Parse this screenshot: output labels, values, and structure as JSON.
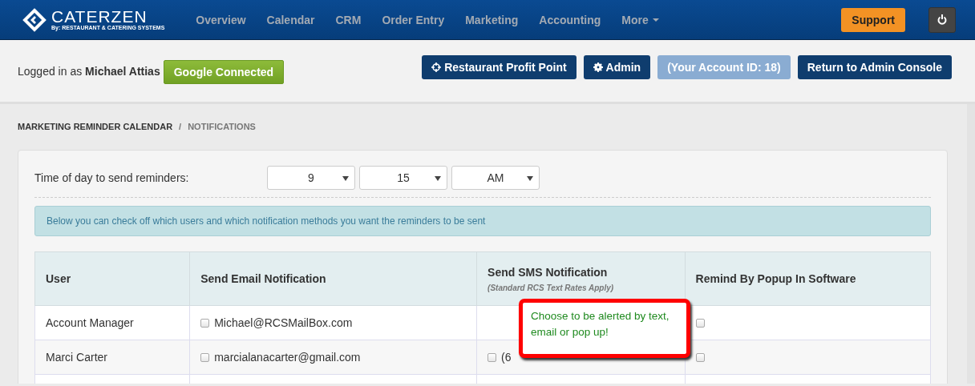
{
  "header": {
    "logo": {
      "name": "CATERZEN",
      "tagline": "By: RESTAURANT & CATERING SYSTEMS"
    },
    "nav": [
      {
        "label": "Overview"
      },
      {
        "label": "Calendar"
      },
      {
        "label": "CRM"
      },
      {
        "label": "Order Entry"
      },
      {
        "label": "Marketing"
      },
      {
        "label": "Accounting"
      },
      {
        "label": "More",
        "dropdown": true
      }
    ],
    "support_button": "Support"
  },
  "user_bar": {
    "logged_in_prefix": "Logged in as",
    "user_name": "Michael Attias",
    "google_button": "Google Connected",
    "buttons": [
      {
        "label": "Restaurant Profit Point",
        "disabled": false
      },
      {
        "label": "Admin",
        "disabled": false
      },
      {
        "label": "(Your Account ID: 18)",
        "disabled": true
      },
      {
        "label": "Return to Admin Console",
        "disabled": false
      }
    ]
  },
  "breadcrumb": {
    "separator": "/",
    "items": [
      {
        "label": "MARKETING REMINDER CALENDAR",
        "current": false
      },
      {
        "label": "NOTIFICATIONS",
        "current": true
      }
    ]
  },
  "time_setting": {
    "label": "Time of day to send reminders:",
    "selects": [
      {
        "value": "9"
      },
      {
        "value": "15"
      },
      {
        "value": "AM"
      }
    ]
  },
  "info_message": "Below you can check off which users and which notification methods you want the reminders to be sent",
  "table": {
    "columns": [
      {
        "title": "User"
      },
      {
        "title": "Send Email Notification"
      },
      {
        "title": "Send SMS Notification",
        "note": "(Standard RCS Text Rates Apply)"
      },
      {
        "title": "Remind By Popup In Software"
      }
    ],
    "rows": [
      {
        "user": "Account Manager",
        "email": {
          "checked": false,
          "text": "Michael@RCSMailBox.com"
        },
        "popup": {
          "checked": false
        }
      },
      {
        "user": "Marci Carter",
        "email": {
          "checked": false,
          "text": "marcialanacarter@gmail.com"
        },
        "sms": {
          "checked": false,
          "text": "(6"
        },
        "popup": {
          "checked": false
        }
      }
    ]
  },
  "callout": "Choose to be alerted by text, email or pop up!"
}
